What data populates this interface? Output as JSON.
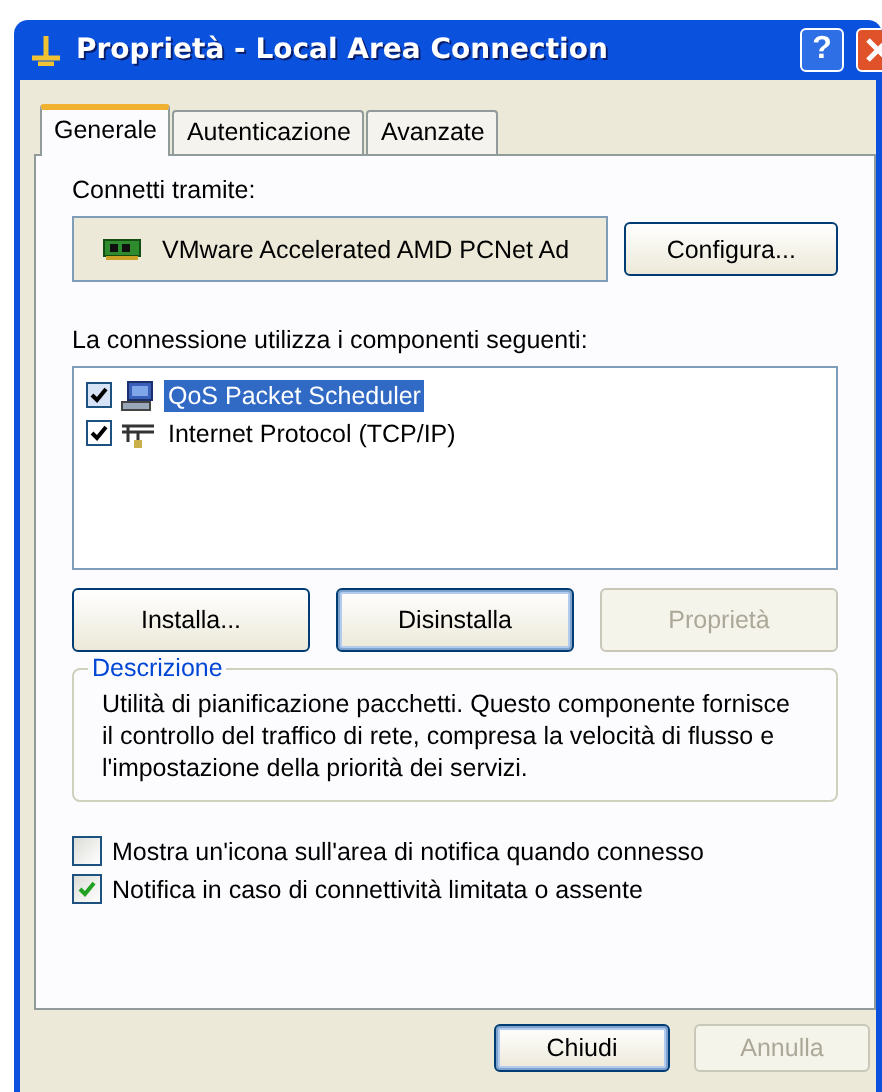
{
  "window": {
    "title": "Proprietà - Local Area Connection",
    "help_button": "?"
  },
  "tabs": [
    {
      "label": "Generale",
      "selected": true
    },
    {
      "label": "Autenticazione",
      "selected": false
    },
    {
      "label": "Avanzate",
      "selected": false
    }
  ],
  "connect_via": {
    "label": "Connetti tramite:",
    "adapter": "VMware Accelerated AMD PCNet Ad",
    "button": "Configura..."
  },
  "components": {
    "label": "La connessione utilizza i componenti seguenti:",
    "items": [
      {
        "name": "QoS Packet Scheduler",
        "kind": "scheduler",
        "checked": true,
        "selected": true
      },
      {
        "name": "Internet Protocol (TCP/IP)",
        "kind": "protocol",
        "checked": true,
        "selected": false
      }
    ]
  },
  "component_buttons": [
    {
      "label": "Installa...",
      "disabled": false,
      "default": false
    },
    {
      "label": "Disinstalla",
      "disabled": false,
      "default": true
    },
    {
      "label": "Proprietà",
      "disabled": true,
      "default": false
    }
  ],
  "description": {
    "title": "Descrizione",
    "text": "Utilità di pianificazione pacchetti. Questo componente fornisce il controllo del traffico di rete, compresa la velocità di flusso e l'impostazione della priorità dei servizi."
  },
  "options": [
    {
      "label": "Mostra un'icona sull'area di notifica quando connesso",
      "checked": false
    },
    {
      "label": "Notifica in caso di connettività limitata o assente",
      "checked": true
    }
  ],
  "footer_buttons": [
    {
      "label": "Chiudi",
      "disabled": false,
      "default": true
    },
    {
      "label": "Annulla",
      "disabled": true,
      "default": false
    }
  ]
}
